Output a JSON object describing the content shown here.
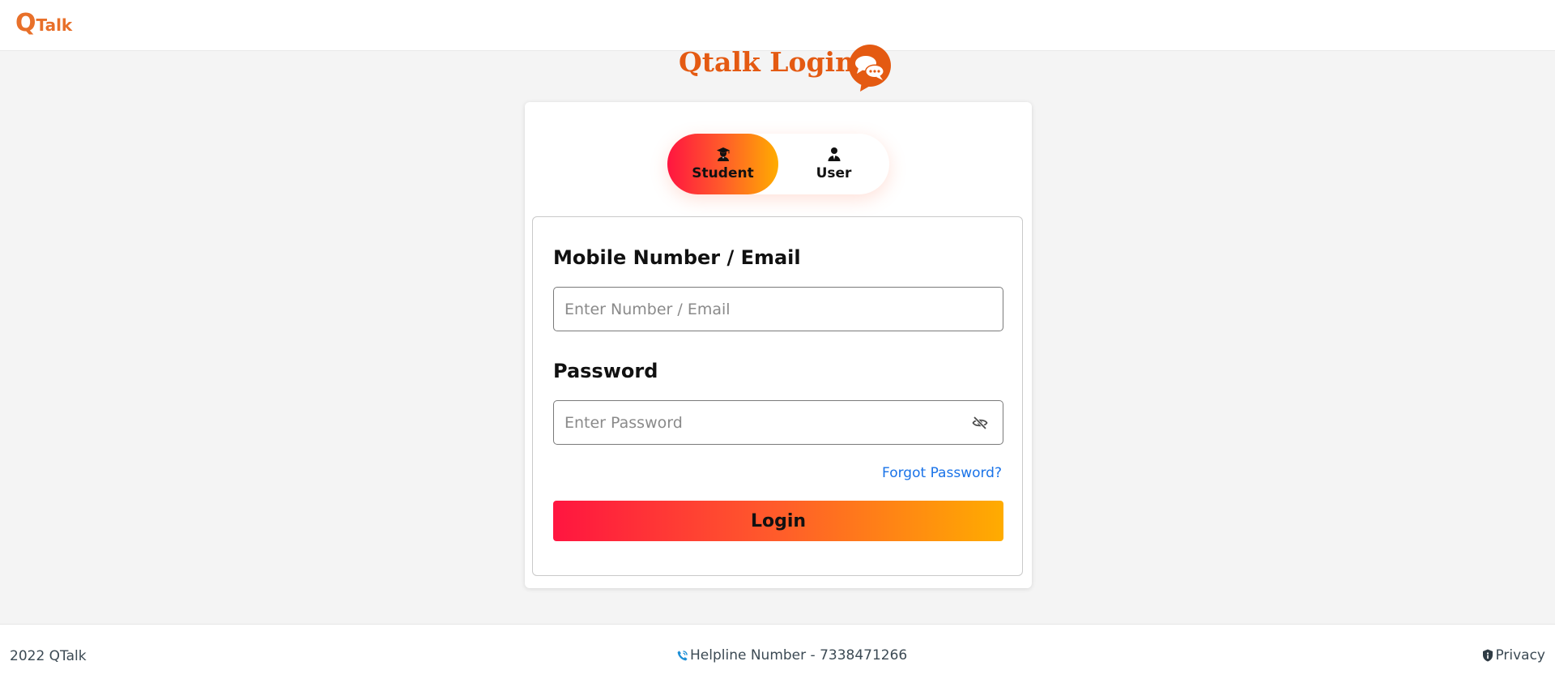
{
  "header": {
    "brand_q": "Q",
    "brand_rest": "Talk"
  },
  "page": {
    "title": "Qtalk Login"
  },
  "login_type": {
    "tabs": [
      {
        "label": "Student",
        "icon": "graduate-icon",
        "selected": true
      },
      {
        "label": "User",
        "icon": "user-icon",
        "selected": false
      }
    ]
  },
  "form": {
    "identifier_label": "Mobile Number / Email",
    "identifier_placeholder": "Enter Number / Email",
    "password_label": "Password",
    "password_placeholder": "Enter Password",
    "forgot_link": "Forgot Password?",
    "login_button": "Login"
  },
  "footer": {
    "copyright": "2022 QTalk",
    "helpline": "Helpline Number - 7338471266",
    "privacy": "Privacy"
  },
  "colors": {
    "brand_orange": "#e45a12",
    "gradient_start": "#ff1540",
    "gradient_end": "#ffac00",
    "link_blue": "#1a73e8"
  }
}
